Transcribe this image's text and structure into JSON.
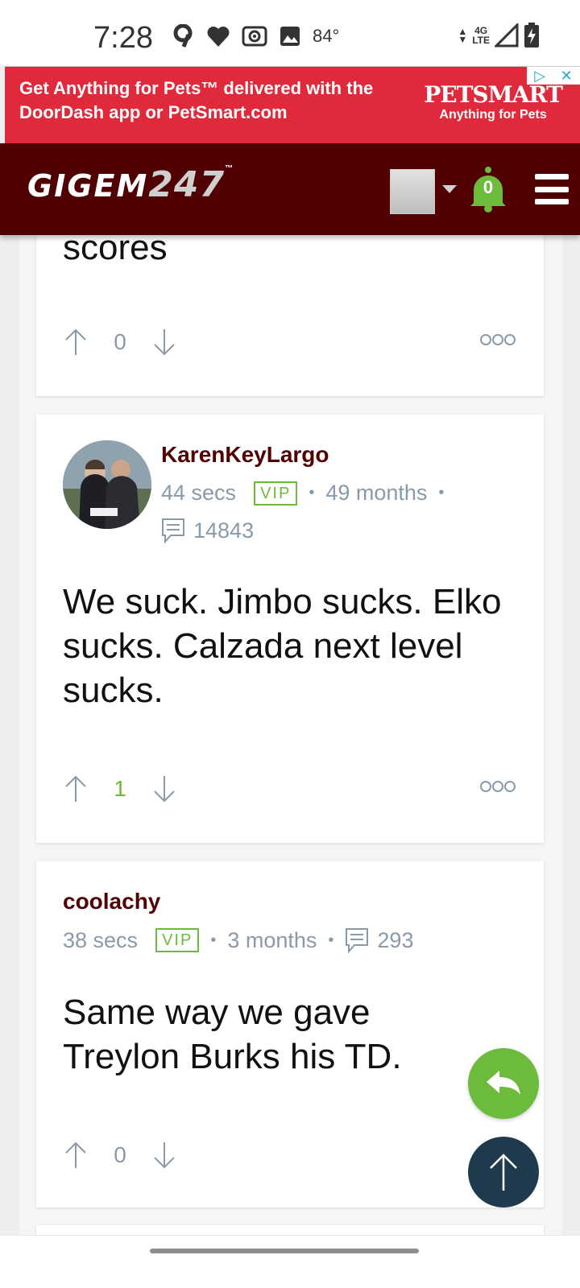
{
  "status_bar": {
    "time": "7:28",
    "temperature": "84°",
    "network_top": "4G",
    "network_bottom": "LTE"
  },
  "ad": {
    "headline": "Get Anything for Pets™ delivered with the DoorDash app or PetSmart.com",
    "brand": "PETSMART",
    "tagline": "Anything for Pets"
  },
  "header": {
    "logo_part1": "GIGEM",
    "logo_part2": "247",
    "notification_count": "0"
  },
  "posts": [
    {
      "body": "scores",
      "votes": "0"
    },
    {
      "author": "KarenKeyLargo",
      "time": "44 secs",
      "badge": "VIP",
      "tenure": "49 months",
      "post_count": "14843",
      "body": "We suck. Jimbo sucks. Elko sucks. Calzada next level sucks.",
      "votes": "1"
    },
    {
      "author": "coolachy",
      "time": "38 secs",
      "badge": "VIP",
      "tenure": "3 months",
      "post_count": "293",
      "body": "Same way we gave Treylon Burks his TD.",
      "votes": "0"
    }
  ],
  "colors": {
    "brand_maroon": "#500000",
    "accent_green": "#6cbb3c",
    "ad_red": "#e0293a",
    "fab_navy": "#1e3a4c",
    "meta_gray": "#8a9aaa"
  }
}
